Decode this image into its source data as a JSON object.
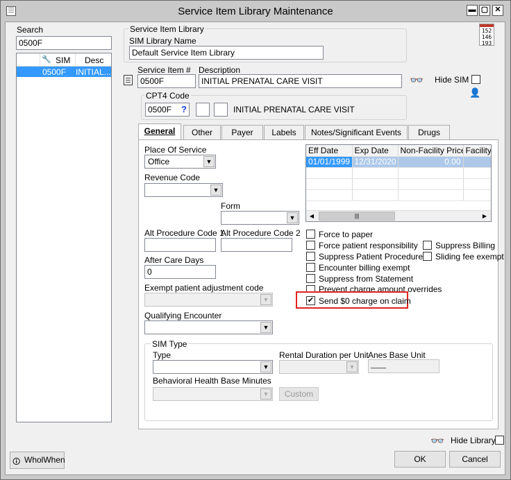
{
  "window": {
    "title": "Service Item Library Maintenance"
  },
  "search": {
    "label": "Search",
    "value": "0500F",
    "columns": [
      "SIM",
      "Desc"
    ],
    "rows": [
      {
        "sim": "0500F",
        "desc": "INITIAL..."
      }
    ]
  },
  "library": {
    "group_label": "Service Item Library",
    "name_label": "SIM Library Name",
    "name_value": "Default Service Item Library"
  },
  "item": {
    "code_label": "Service Item #",
    "code_value": "0500F",
    "desc_label": "Description",
    "desc_value": "INITIAL PRENATAL CARE VISIT",
    "hide_sim_label": "Hide SIM"
  },
  "cpt4": {
    "label": "CPT4 Code",
    "value": "0500F",
    "help": "?",
    "desc": "INITIAL PRENATAL CARE VISIT"
  },
  "tabs": [
    {
      "label": "General",
      "active": true
    },
    {
      "label": "Other"
    },
    {
      "label": "Payer"
    },
    {
      "label": "Labels"
    },
    {
      "label": "Notes/Significant Events"
    },
    {
      "label": "Drugs"
    }
  ],
  "general": {
    "place_label": "Place Of Service",
    "place_value": "Office",
    "revenue_label": "Revenue Code",
    "revenue_value": "",
    "form_label": "Form",
    "form_value": "",
    "alt1_label": "Alt Procedure Code 1",
    "alt1_value": "",
    "alt2_label": "Alt Procedure Code 2",
    "alt2_value": "",
    "after_label": "After Care Days",
    "after_value": "0",
    "exempt_label": "Exempt patient adjustment code",
    "qual_label": "Qualifying Encounter"
  },
  "fee_grid": {
    "columns": [
      "Eff Date",
      "Exp Date",
      "Non-Facility Price",
      "Facility F"
    ],
    "rows": [
      [
        "01/01/1999",
        "12/31/2020",
        "0.00",
        ""
      ]
    ]
  },
  "checkboxes_left": [
    {
      "label": "Force to paper",
      "checked": false
    },
    {
      "label": "Force patient responsibility",
      "checked": false
    },
    {
      "label": "Suppress Patient Procedure",
      "checked": false
    },
    {
      "label": "Encounter billing exempt",
      "checked": false
    },
    {
      "label": "Suppress from Statement",
      "checked": false
    },
    {
      "label": "Prevent charge amount overrides",
      "checked": false
    },
    {
      "label": "Send $0 charge on claim",
      "checked": true
    }
  ],
  "checkboxes_right": [
    {
      "label": "Suppress Billing",
      "checked": false
    },
    {
      "label": "Sliding fee exempt",
      "checked": false
    }
  ],
  "sim_type": {
    "group_label": "SIM Type",
    "type_label": "Type",
    "rental_label": "Rental Duration per Unit",
    "anes_label": "Anes Base Unit",
    "anes_value": "____",
    "bh_label": "Behavioral Health Base Minutes",
    "custom_label": "Custom"
  },
  "footer": {
    "hide_library_label": "Hide Library",
    "ok_label": "OK",
    "cancel_label": "Cancel",
    "whowhen_label": "WholWhen"
  },
  "calendar_icon": {
    "lines": [
      "152",
      "146",
      "193"
    ]
  },
  "colors": {
    "selection": "#3399ff",
    "highlight_box": "#e02020"
  }
}
